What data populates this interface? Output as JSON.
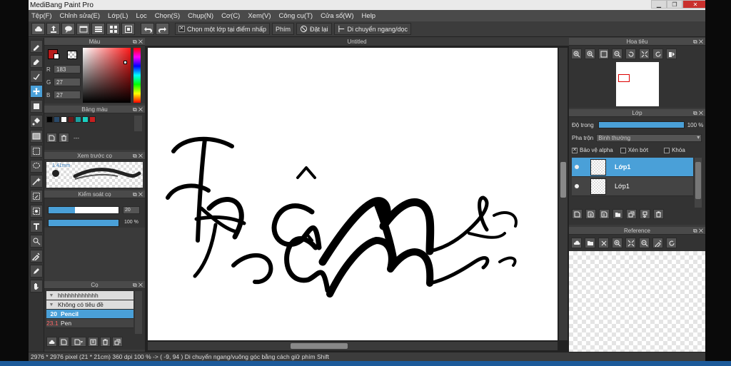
{
  "window": {
    "title": "MediBang Paint Pro"
  },
  "menu": [
    "Tệp(F)",
    "Chỉnh sửa(E)",
    "Lớp(L)",
    "Lọc",
    "Chọn(S)",
    "Chụp(N)",
    "Cơ(C)",
    "Xem(V)",
    "Công cụ(T)",
    "Cửa sổ(W)",
    "Help"
  ],
  "toolbar": {
    "select_layer_label": "Chọn một lớp tại điểm nhấp",
    "key_label": "Phím",
    "reset_label": "Đặt lại",
    "move_label": "Di chuyển ngang/dọc"
  },
  "color_panel": {
    "title": "Màu",
    "r_label": "R",
    "g_label": "G",
    "b_label": "B",
    "r": "183",
    "g": "27",
    "b": "27",
    "fg_color": "#b71b1b"
  },
  "palette_panel": {
    "title": "Bảng màu",
    "swatches": [
      "#000000",
      "#2a4a6a",
      "#ffffff",
      "#6a1a1a",
      "#1aa0a0",
      "#1ad0c0",
      "#c82020"
    ],
    "extra": "---"
  },
  "preview_panel": {
    "title": "Xem trước cọ",
    "size": "1.41mm"
  },
  "brush_control": {
    "title": "Kiểm soát cọ",
    "size": "20",
    "opacity": "100 %",
    "size_fraction": 0.38,
    "opacity_fraction": 1.0
  },
  "brush_panel": {
    "title": "Cọ",
    "items": [
      {
        "size": "",
        "name": "hhhhhhhhhhhh",
        "kind": "group"
      },
      {
        "size": "",
        "name": "Không có tiêu đề",
        "kind": "group"
      },
      {
        "size": "20",
        "name": "Pencil",
        "kind": "selected"
      },
      {
        "size": "23.1",
        "name": "Pen",
        "kind": "dark"
      }
    ]
  },
  "canvas": {
    "doc_title": "Untitled"
  },
  "navigator": {
    "title": "Hoa tiêu"
  },
  "layer_panel": {
    "title": "Lớp",
    "opacity_label": "Độ trong",
    "opacity": "100 %",
    "blend_label": "Pha trộn",
    "blend_value": "Bình thường",
    "protect_alpha": "Bảo vệ alpha",
    "clip": "Xén bớt",
    "lock": "Khóa",
    "layers": [
      {
        "name": "Lớp1",
        "selected": true
      },
      {
        "name": "Lớp1",
        "selected": false
      }
    ]
  },
  "reference_panel": {
    "title": "Reference"
  },
  "status": {
    "text": "2976 * 2976 pixel  (21 * 21cm)  360 dpi  100 %  -> ( -9, 94 )  Di chuyển ngang/vuông góc bằng cách giữ phím Shift"
  },
  "colors": {
    "accent": "#4aa0d8",
    "panel": "#333333",
    "close": "#c9302c"
  }
}
